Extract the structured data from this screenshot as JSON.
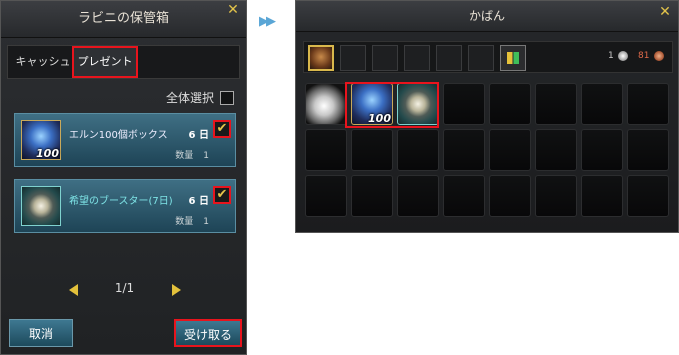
{
  "storage": {
    "title": "ラビニの保管箱",
    "tabs": [
      "キャッシュ",
      "プレゼント"
    ],
    "select_all_label": "全体選択",
    "items": [
      {
        "name": "エルン100個ボックス",
        "days": "6 日",
        "qty_label": "数量",
        "qty": "1",
        "badge": "100",
        "checked": true
      },
      {
        "name": "希望のブースター(7日)",
        "days": "6 日",
        "qty_label": "数量",
        "qty": "1",
        "checked": true
      }
    ],
    "pager": "1/1",
    "cancel_label": "取消",
    "receive_label": "受け取る"
  },
  "bag": {
    "title": "かばん",
    "currency1": "1",
    "currency2": "81",
    "badge": "100"
  },
  "colors": {
    "highlight": "#e8141d",
    "accent_gold": "#e3c13b",
    "item_teal": "#3f6f84"
  }
}
